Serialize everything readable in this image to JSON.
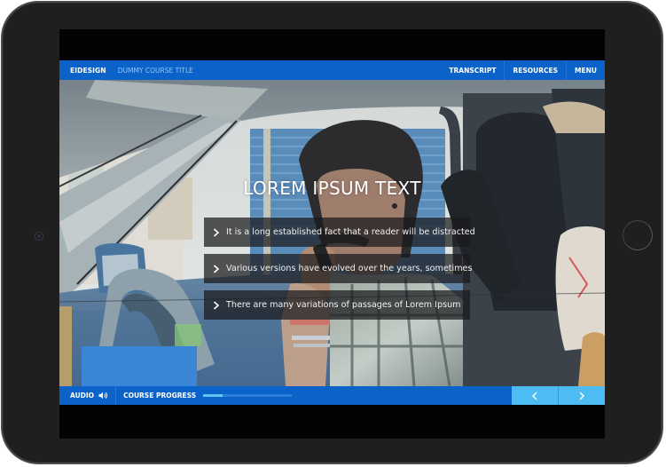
{
  "header": {
    "brand": "EIDESIGN",
    "course_title": "DUMMY COURSE TITLE",
    "nav": [
      {
        "label": "TRANSCRIPT"
      },
      {
        "label": "RESOURCES"
      },
      {
        "label": "MENU"
      }
    ]
  },
  "slide": {
    "title": "LOREM IPSUM TEXT",
    "bullets": [
      {
        "text": "It is a long established fact that a reader will be distracted",
        "icon": "chevron-right-icon"
      },
      {
        "text": "Various versions have evolved over the years, sometimes",
        "icon": "chevron-right-icon"
      },
      {
        "text": "There are many variations of passages of Lorem Ipsum",
        "icon": "chevron-right-icon"
      }
    ],
    "background": "video still: man talking on phone in car"
  },
  "footer": {
    "audio_label": "AUDIO",
    "audio_icon": "speaker-icon",
    "progress_label": "COURSE PROGRESS",
    "progress_percent": 22,
    "prev_icon": "chevron-left-icon",
    "next_icon": "chevron-right-icon"
  },
  "colors": {
    "bar_blue": "#0b62c8",
    "accent_light_blue": "#4cbcf2",
    "progress_fill": "#5cc6f5",
    "frame": "#1f1f1f"
  }
}
